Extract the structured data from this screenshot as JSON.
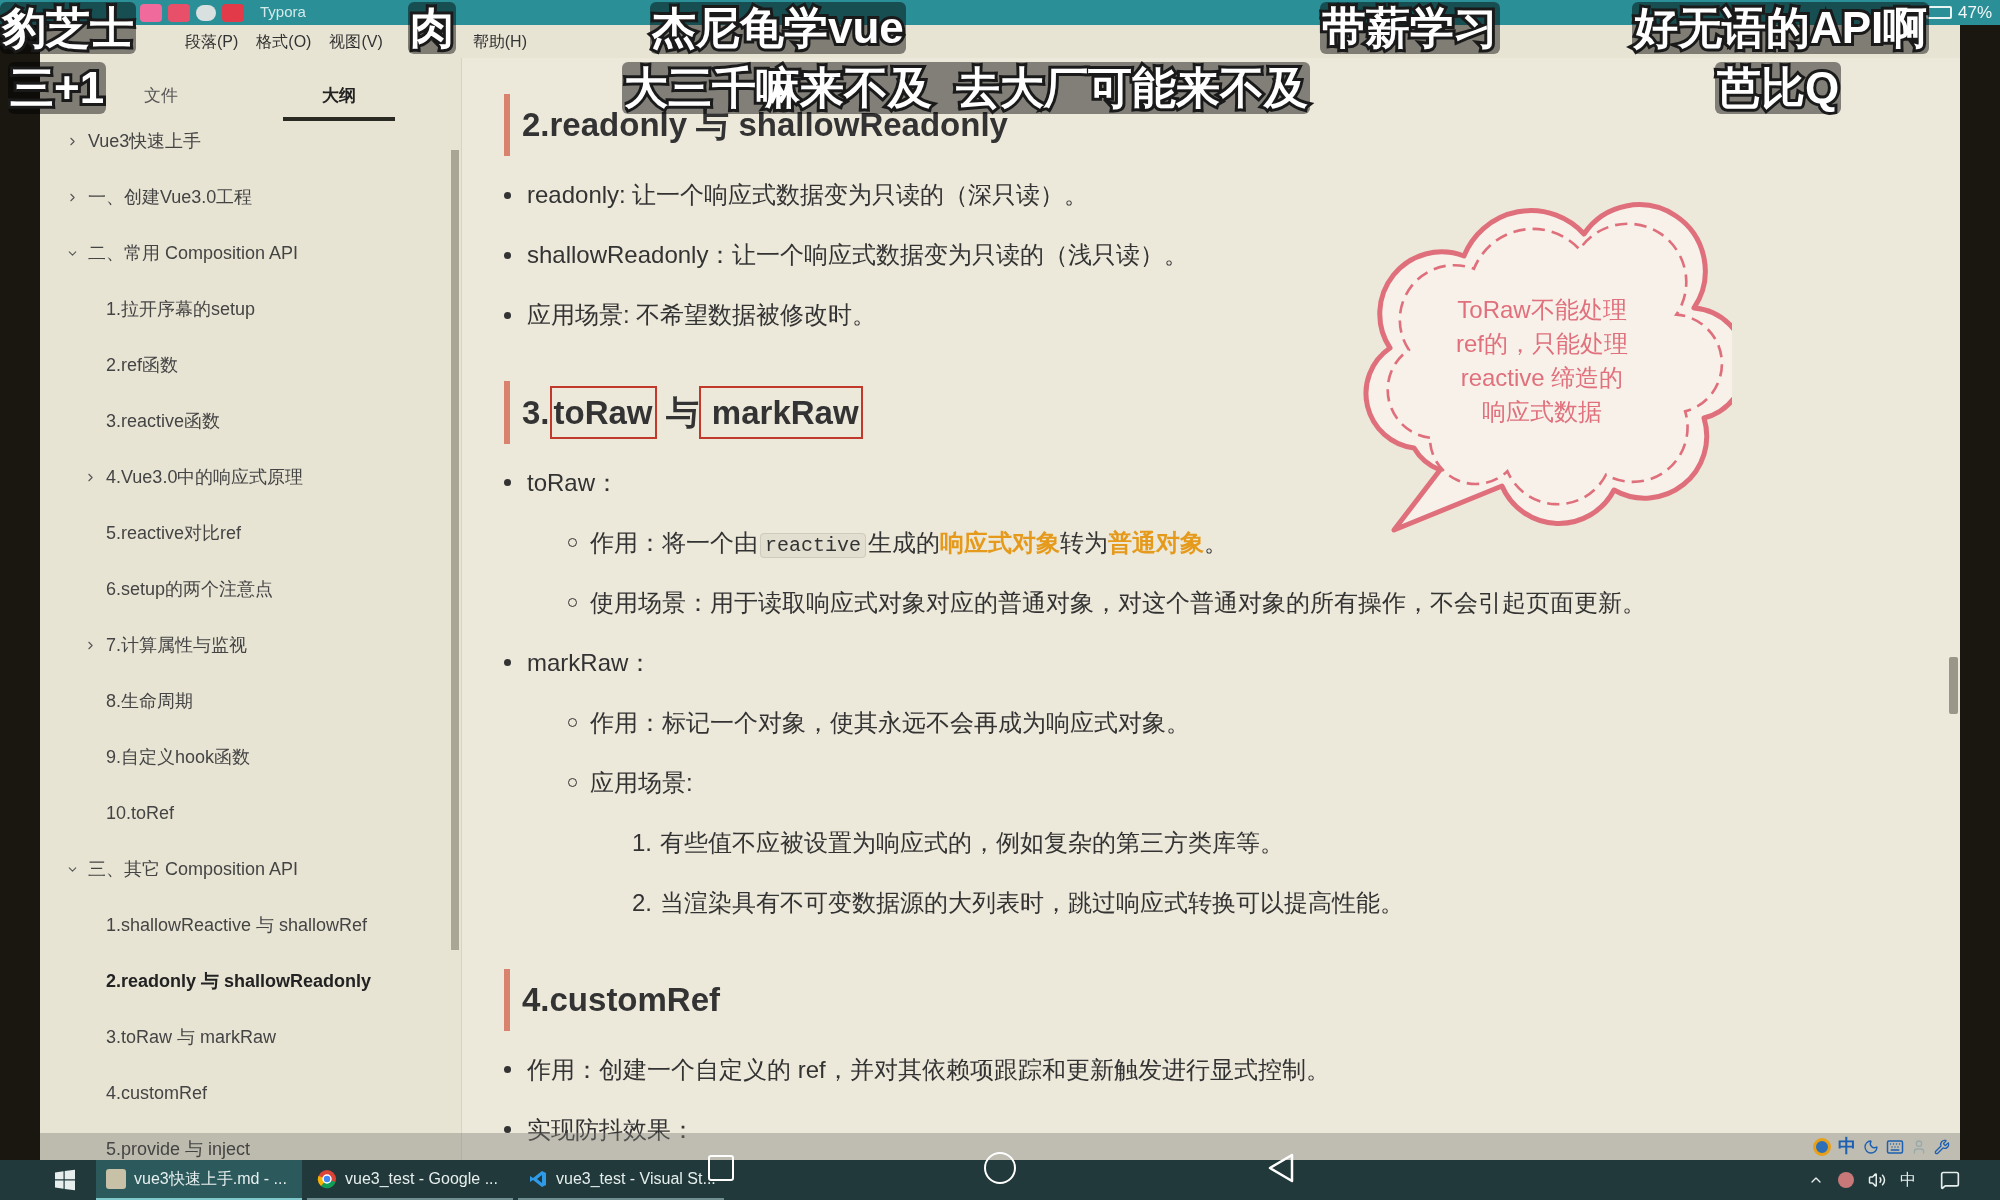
{
  "title_bar": {
    "app_title": "Typora",
    "battery": "47%"
  },
  "menu": [
    {
      "label": "段落(P)"
    },
    {
      "label": "格式(O)"
    },
    {
      "label": "视图(V)"
    },
    {
      "label": "帮助(H)"
    }
  ],
  "sidebar": {
    "tabs": [
      {
        "label": "文件",
        "selected": false
      },
      {
        "label": "大纲",
        "selected": true
      }
    ],
    "outline": [
      {
        "label": "Vue3快速上手",
        "expanded": false,
        "selected": false
      },
      {
        "label": "一、创建Vue3.0工程",
        "expanded": false,
        "selected": false
      },
      {
        "label": "二、常用 Composition API",
        "expanded": true,
        "selected": false,
        "children": [
          {
            "label": "1.拉开序幕的setup",
            "selected": false
          },
          {
            "label": "2.ref函数",
            "selected": false
          },
          {
            "label": "3.reactive函数",
            "selected": false
          },
          {
            "label": "4.Vue3.0中的响应式原理",
            "expanded": false,
            "selected": false
          },
          {
            "label": "5.reactive对比ref",
            "selected": false
          },
          {
            "label": "6.setup的两个注意点",
            "selected": false
          },
          {
            "label": "7.计算属性与监视",
            "expanded": false,
            "selected": false
          },
          {
            "label": "8.生命周期",
            "selected": false
          },
          {
            "label": "9.自定义hook函数",
            "selected": false
          },
          {
            "label": "10.toRef",
            "selected": false
          }
        ]
      },
      {
        "label": "三、其它 Composition API",
        "expanded": true,
        "selected": false,
        "children": [
          {
            "label": "1.shallowReactive 与 shallowRef",
            "selected": false
          },
          {
            "label": "2.readonly 与 shallowReadonly",
            "selected": true
          },
          {
            "label": "3.toRaw 与 markRaw",
            "selected": false
          },
          {
            "label": "4.customRef",
            "selected": false
          },
          {
            "label": "5.provide 与 inject",
            "selected": false
          }
        ]
      }
    ]
  },
  "document": [
    {
      "kind": "heading",
      "parts": [
        {
          "text": "2.readonly 与 shallowReadonly"
        }
      ]
    },
    {
      "kind": "bullet",
      "parts": [
        {
          "text": "readonly: 让一个响应式数据变为只读的（深只读）。"
        }
      ]
    },
    {
      "kind": "bullet",
      "parts": [
        {
          "text": "shallowReadonly：让一个响应式数据变为只读的（浅只读）。"
        }
      ]
    },
    {
      "kind": "bullet",
      "parts": [
        {
          "text": "应用场景: 不希望数据被修改时。"
        }
      ]
    },
    {
      "kind": "heading",
      "parts": [
        {
          "text": "3."
        },
        {
          "text": "toRaw",
          "kind": "boxed"
        },
        {
          "text": " 与"
        },
        {
          "text": " markRaw",
          "kind": "boxed"
        }
      ]
    },
    {
      "kind": "bullet",
      "parts": [
        {
          "text": "toRaw："
        }
      ],
      "children": [
        {
          "kind": "circle",
          "parts": [
            {
              "text": "作用：将一个由"
            },
            {
              "text": "reactive",
              "kind": "code"
            },
            {
              "text": "生成的"
            },
            {
              "text": "响应式对象",
              "kind": "highlight"
            },
            {
              "text": "转为"
            },
            {
              "text": "普通对象",
              "kind": "highlight"
            },
            {
              "text": "。"
            }
          ]
        },
        {
          "kind": "circle",
          "parts": [
            {
              "text": "使用场景：用于读取响应式对象对应的普通对象，对这个普通对象的所有操作，不会引起页面更新。"
            }
          ]
        }
      ]
    },
    {
      "kind": "bullet",
      "parts": [
        {
          "text": "markRaw："
        }
      ],
      "children": [
        {
          "kind": "circle",
          "parts": [
            {
              "text": "作用：标记一个对象，使其永远不会再成为响应式对象。"
            }
          ]
        },
        {
          "kind": "circle",
          "parts": [
            {
              "text": "应用场景:"
            }
          ],
          "children": [
            {
              "kind": "numbered",
              "marker": "1.",
              "parts": [
                {
                  "text": "有些值不应被设置为响应式的，例如复杂的第三方类库等。"
                }
              ]
            },
            {
              "kind": "numbered",
              "marker": "2.",
              "parts": [
                {
                  "text": "当渲染具有不可变数据源的大列表时，跳过响应式转换可以提高性能。"
                }
              ]
            }
          ]
        }
      ]
    },
    {
      "kind": "heading",
      "parts": [
        {
          "text": "4.customRef"
        }
      ]
    },
    {
      "kind": "bullet",
      "parts": [
        {
          "text": "作用：创建一个自定义的 ref，并对其依赖项跟踪和更新触发进行显式控制。"
        }
      ]
    },
    {
      "kind": "bullet",
      "parts": [
        {
          "text": "实现防抖效果："
        }
      ]
    }
  ],
  "callout": {
    "lines": [
      "ToRaw不能处理",
      "ref的，只能处理",
      "reactive 缔造的",
      "响应式数据"
    ]
  },
  "overlay_comments": [
    {
      "text": "豹芝士"
    },
    {
      "text": "肉"
    },
    {
      "text": "杰尼龟学vue"
    },
    {
      "text": "带薪学习"
    },
    {
      "text": "好无语的API啊"
    },
    {
      "text": "三+1"
    },
    {
      "text": "大三千嘛来不及  去大厂可能来不及"
    },
    {
      "text": "芭比Q"
    }
  ],
  "ime_bar": {
    "mode": "中"
  },
  "taskbar": {
    "items": [
      {
        "kind": "typora",
        "label": "vue3快速上手.md - ...",
        "selected": true
      },
      {
        "kind": "chrome",
        "label": "vue3_test - Google ...",
        "selected": false
      },
      {
        "kind": "vscode",
        "label": "vue3_test - Visual St...",
        "selected": false
      }
    ],
    "input_language": "中"
  }
}
